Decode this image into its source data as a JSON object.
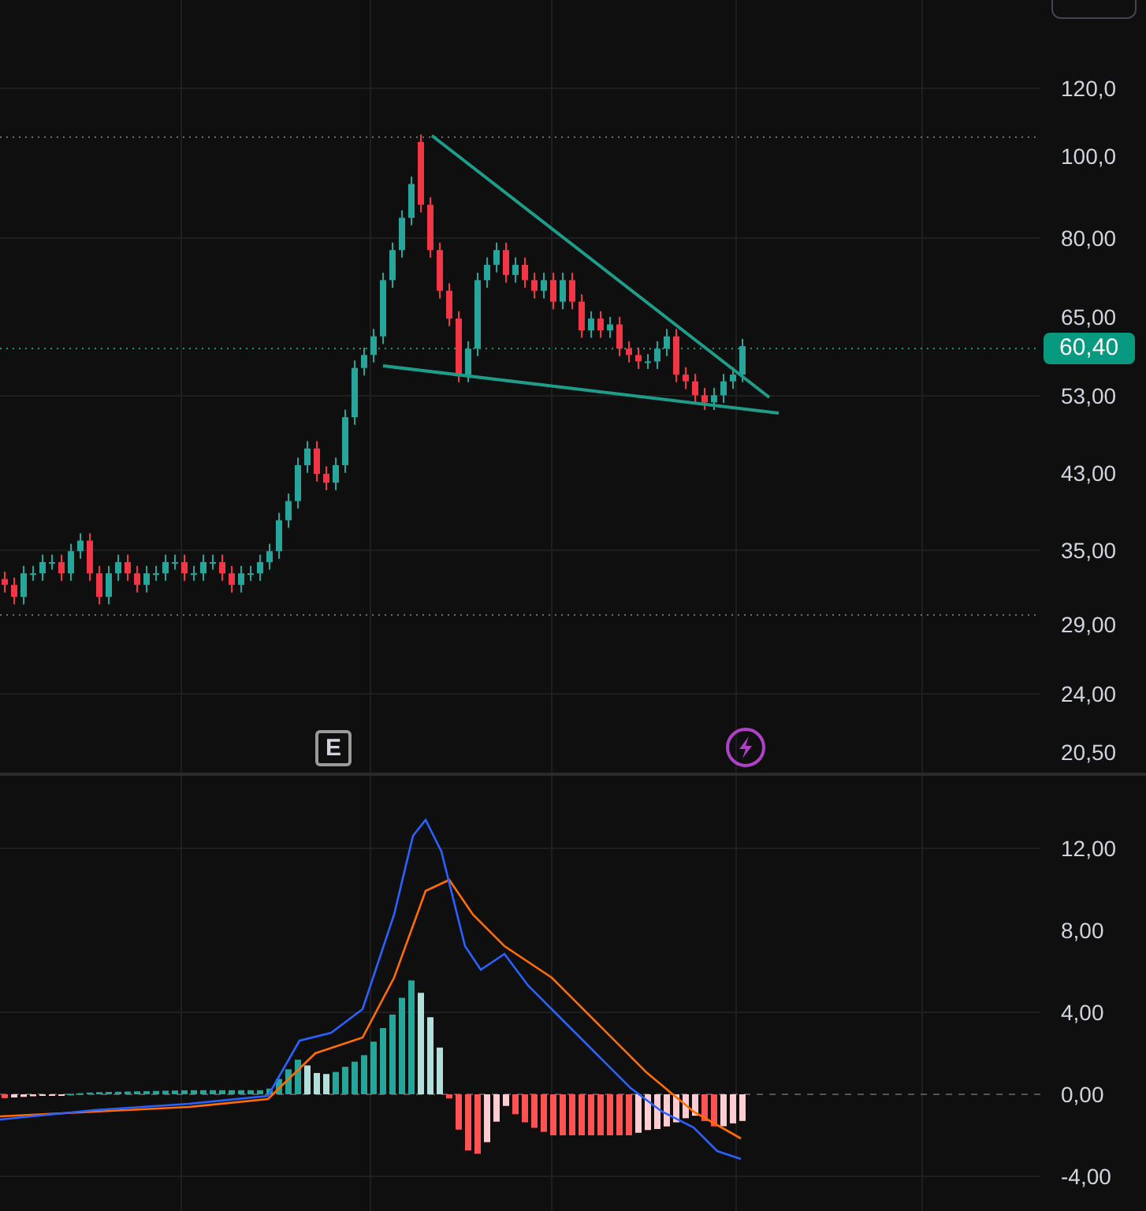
{
  "price_axis": {
    "labels": [
      "120,0",
      "100,0",
      "80,00",
      "65,00",
      "53,00",
      "43,00",
      "35,00",
      "29,00",
      "24,00",
      "20,50"
    ]
  },
  "last_price": {
    "label": "60,40"
  },
  "macd_axis": {
    "labels": [
      "12,00",
      "8,00",
      "4,00",
      "0,00",
      "-4,00"
    ]
  },
  "markers": [
    {
      "kind": "earnings",
      "label": "E"
    },
    {
      "kind": "flash"
    }
  ]
}
